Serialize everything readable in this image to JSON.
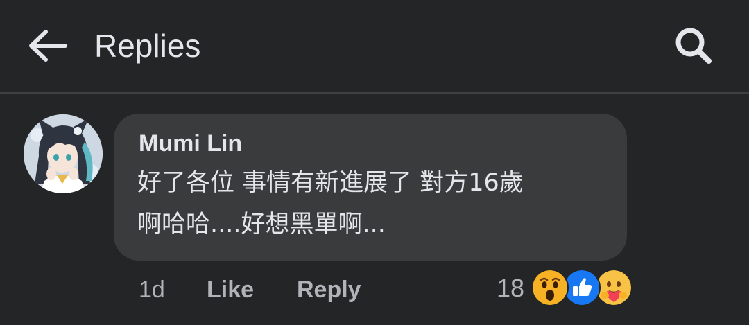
{
  "header": {
    "title": "Replies",
    "back_icon": "arrow-left-icon",
    "search_icon": "search-icon"
  },
  "comment": {
    "author": "Mumi Lin",
    "text_line1": "好了各位 事情有新進展了 對方16歲",
    "text_line2": "啊哈哈....好想黑單啊...",
    "avatar_icon": "anime-girl-avatar",
    "time": "1d",
    "like_label": "Like",
    "reply_label": "Reply",
    "reaction_count": "18",
    "reactions": [
      "wow-reaction-icon",
      "like-reaction-icon",
      "care-reaction-icon"
    ]
  },
  "colors": {
    "background": "#242526",
    "bubble": "#3a3b3c",
    "primary_text": "#e4e6eb",
    "secondary_text": "#b0b3b8",
    "like_blue": "#1877f2",
    "wow_yellow": "#f7b125"
  }
}
